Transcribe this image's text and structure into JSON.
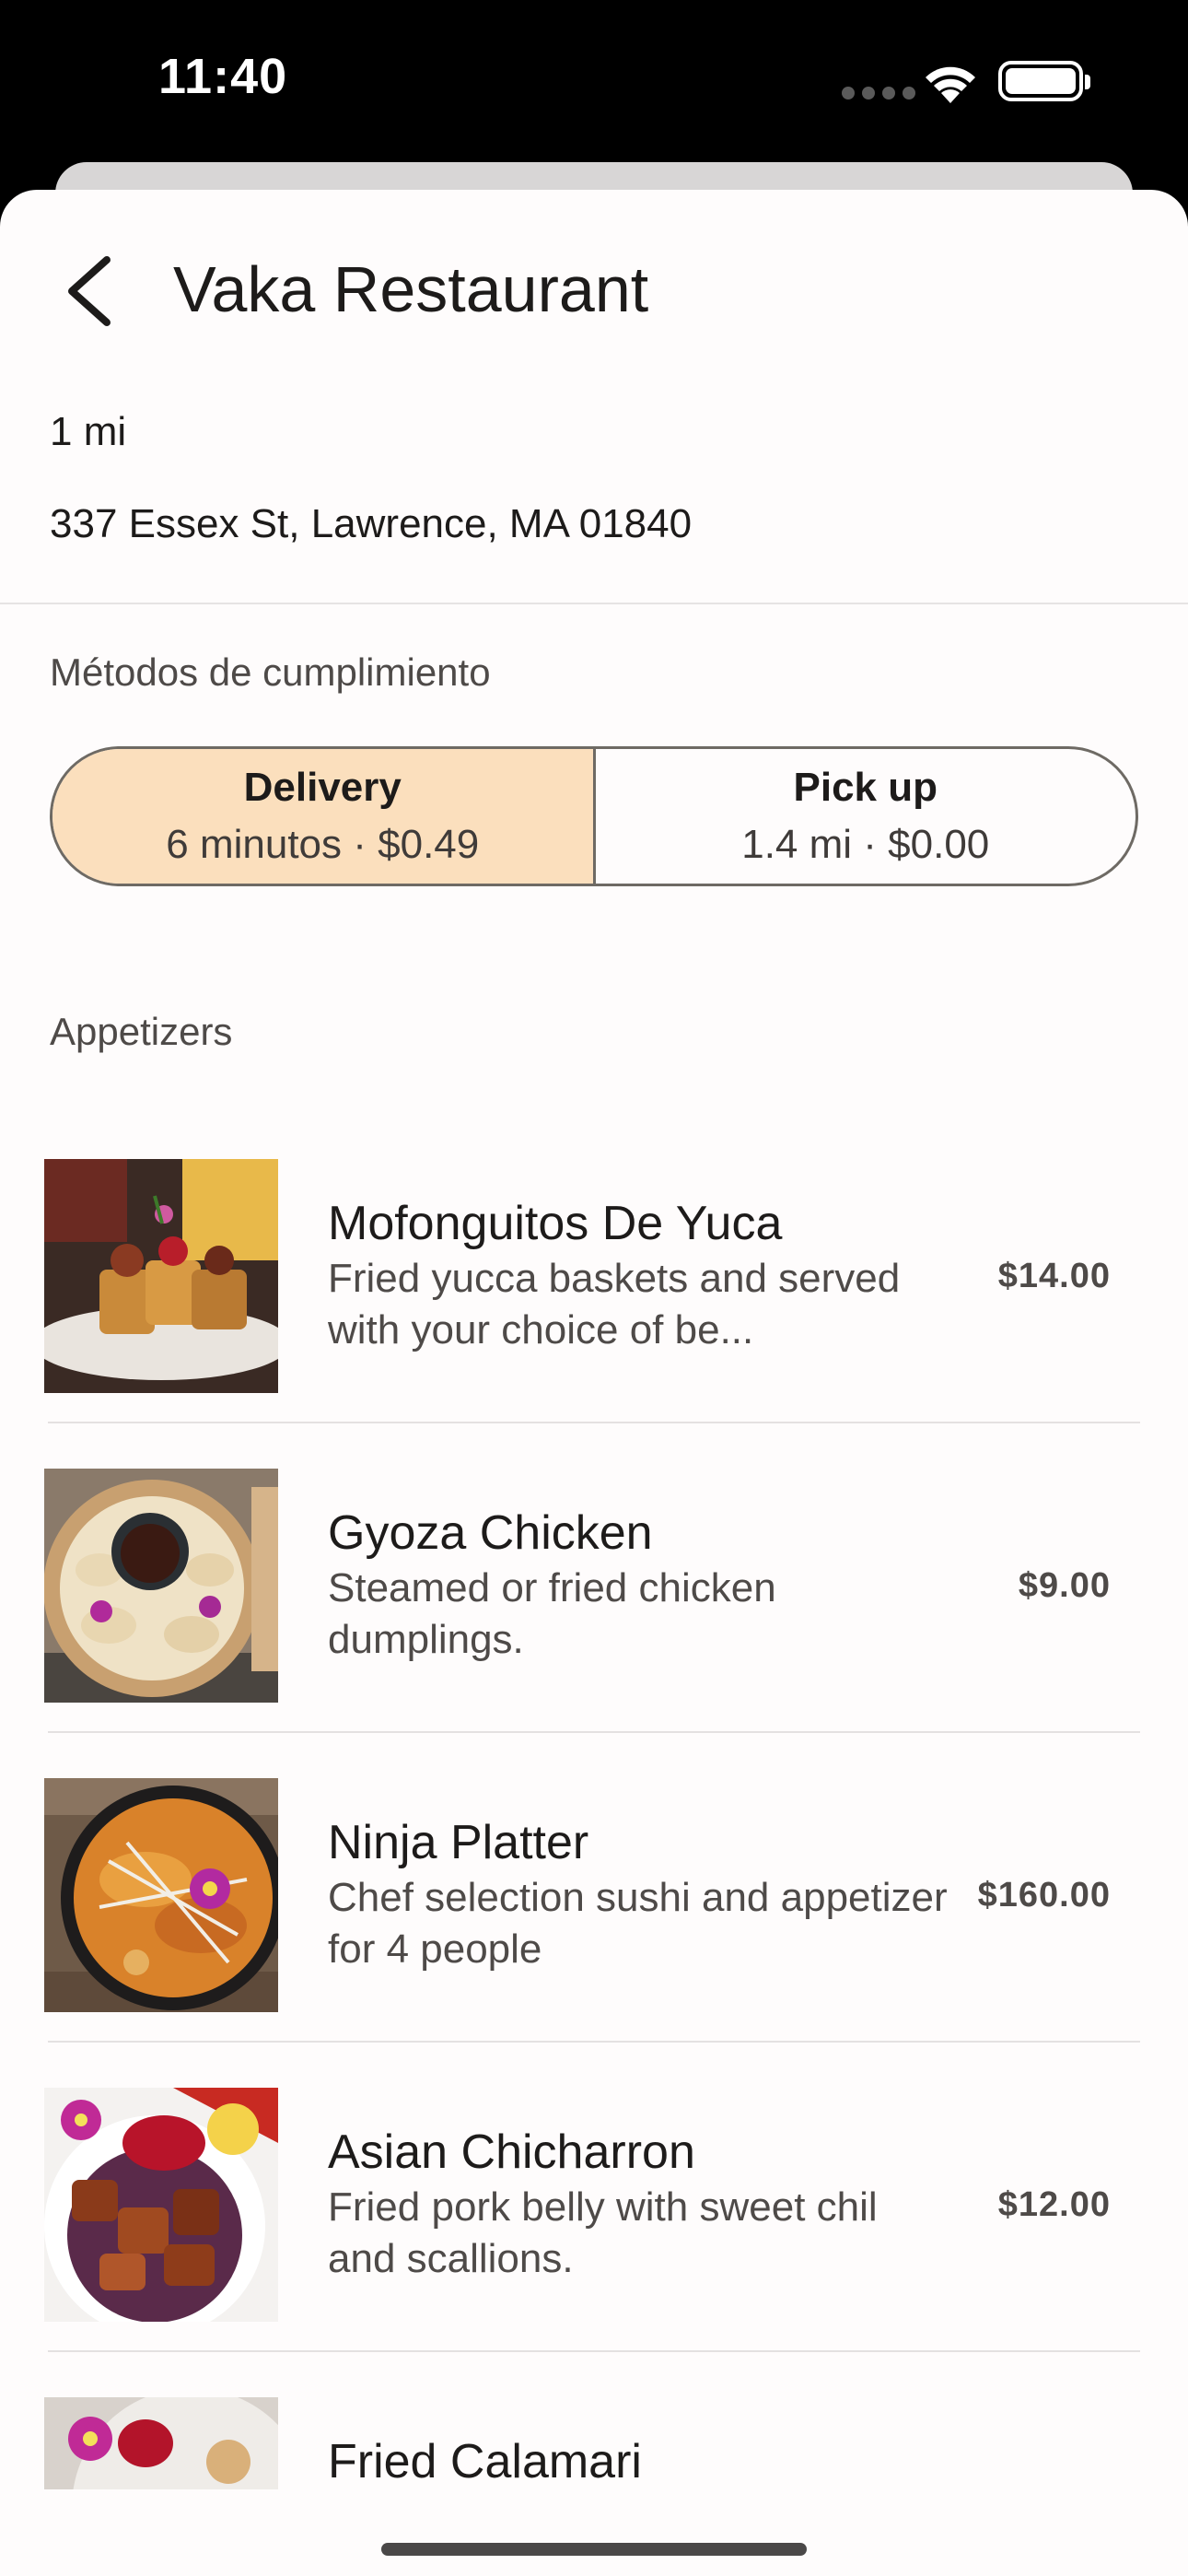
{
  "status_bar": {
    "time": "11:40"
  },
  "header": {
    "title": "Vaka Restaurant"
  },
  "restaurant": {
    "distance": "1 mi",
    "address": "337 Essex St, Lawrence, MA 01840"
  },
  "fulfillment": {
    "label": "Métodos de cumplimiento",
    "options": [
      {
        "title": "Delivery",
        "subtitle": "6 minutos · $0.49",
        "selected": true
      },
      {
        "title": "Pick up",
        "subtitle": "1.4 mi · $0.00",
        "selected": false
      }
    ]
  },
  "menu": {
    "section_label": "Appetizers",
    "items": [
      {
        "name": "Mofonguitos De Yuca",
        "description": "Fried yucca baskets and served with your choice of be...",
        "price": "$14.00"
      },
      {
        "name": "Gyoza Chicken",
        "description": "Steamed or fried chicken dumplings.",
        "price": "$9.00"
      },
      {
        "name": "Ninja Platter",
        "description": "Chef selection sushi and appetizer for 4 people",
        "price": "$160.00"
      },
      {
        "name": "Asian Chicharron",
        "description": "Fried pork belly with sweet chil and scallions.",
        "price": "$12.00"
      },
      {
        "name": "Fried Calamari",
        "description": "",
        "price": ""
      }
    ]
  },
  "colors": {
    "selected_segment": "#fbdfbd",
    "sheet_background": "#fefcfc"
  }
}
